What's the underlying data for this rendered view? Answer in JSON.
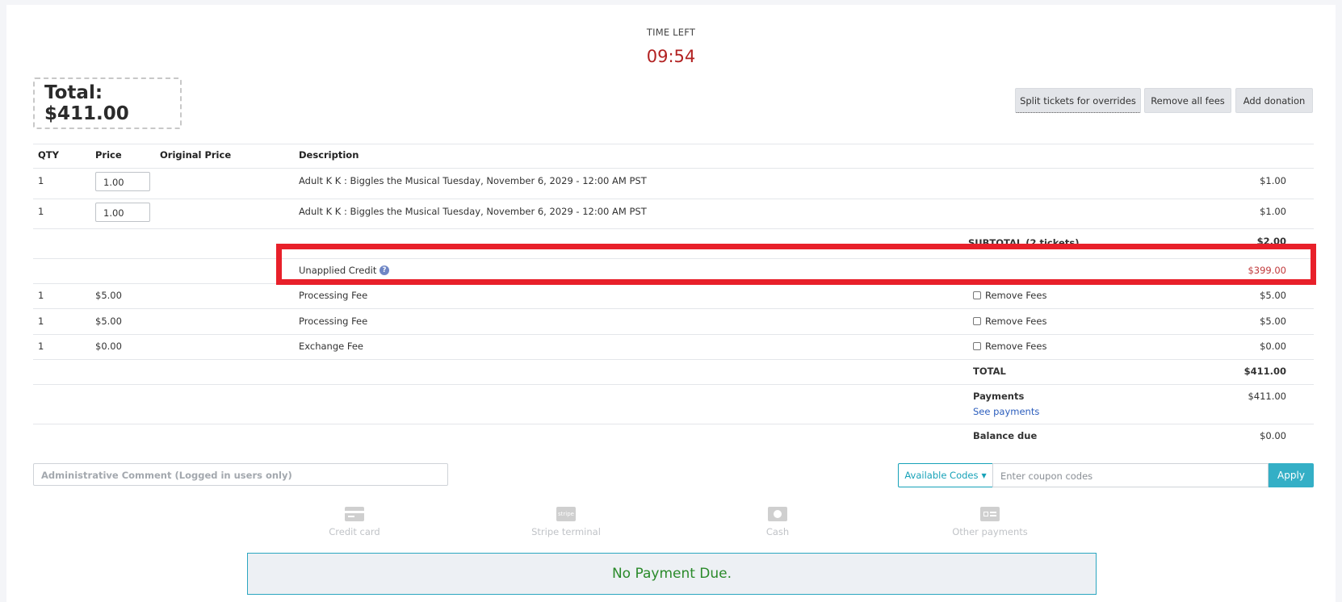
{
  "timer": {
    "label": "TIME LEFT",
    "value": "09:54"
  },
  "total": {
    "label": "Total: $411.00"
  },
  "actions": {
    "split_label": "Split tickets for overrides",
    "remove_fees_label": "Remove all fees",
    "donation_label": "Add donation"
  },
  "table": {
    "headers": {
      "qty": "QTY",
      "price": "Price",
      "original_price": "Original Price",
      "description": "Description"
    },
    "tickets": [
      {
        "qty": "1",
        "price": "1.00",
        "description": "Adult K K : Biggles the Musical Tuesday, November 6, 2029 - 12:00 AM PST",
        "amount": "$1.00"
      },
      {
        "qty": "1",
        "price": "1.00",
        "description": "Adult K K : Biggles the Musical Tuesday, November 6, 2029 - 12:00 AM PST",
        "amount": "$1.00"
      }
    ],
    "subtotal": {
      "label": "SUBTOTAL (2 tickets)",
      "amount": "$2.00"
    },
    "credit": {
      "label": "Unapplied Credit",
      "help": "?",
      "amount": "$399.00"
    },
    "fees": [
      {
        "qty": "1",
        "price": "$5.00",
        "description": "Processing Fee",
        "remove_label": "Remove Fees",
        "amount": "$5.00"
      },
      {
        "qty": "1",
        "price": "$5.00",
        "description": "Processing Fee",
        "remove_label": "Remove Fees",
        "amount": "$5.00"
      },
      {
        "qty": "1",
        "price": "$0.00",
        "description": "Exchange Fee",
        "remove_label": "Remove Fees",
        "amount": "$0.00"
      }
    ],
    "total": {
      "label": "TOTAL",
      "amount": "$411.00"
    },
    "payments": {
      "label": "Payments",
      "link": "See payments",
      "amount": "$411.00"
    },
    "balance": {
      "label": "Balance due",
      "amount": "$0.00"
    }
  },
  "admin_comment": {
    "placeholder": "Administrative Comment (Logged in users only)"
  },
  "coupon": {
    "codes_label": "Available Codes",
    "placeholder": "Enter coupon codes",
    "apply_label": "Apply"
  },
  "payment_options": [
    {
      "label": "Credit card",
      "icon": "credit-card-icon"
    },
    {
      "label": "Stripe terminal",
      "icon": "stripe-icon"
    },
    {
      "label": "Cash",
      "icon": "cash-icon"
    },
    {
      "label": "Other payments",
      "icon": "other-payments-icon"
    }
  ],
  "stripe_icon_text": "stripe",
  "status_message": "No Payment Due.",
  "colors": {
    "timer": "#b22222",
    "credit": "#c0393b",
    "highlight": "#e8202a",
    "accent": "#17a2b8",
    "success": "#2a8a2a"
  }
}
